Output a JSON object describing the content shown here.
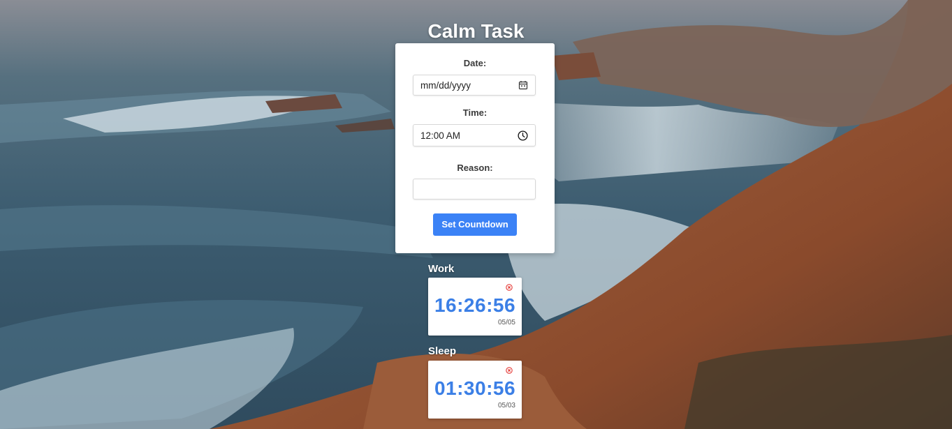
{
  "app": {
    "title": "Calm Task"
  },
  "form": {
    "date_label": "Date:",
    "date_value": "mm/dd/yyyy",
    "date_icon": "calendar-icon",
    "time_label": "Time:",
    "time_value": "12:00 AM",
    "time_icon": "clock-icon",
    "reason_label": "Reason:",
    "reason_value": "",
    "submit_label": "Set Countdown"
  },
  "countdowns": [
    {
      "title": "Work",
      "time": "16:26:56",
      "date": "05/05",
      "icon": "close-icon"
    },
    {
      "title": "Sleep",
      "time": "01:30:56",
      "date": "05/03",
      "icon": "close-icon"
    }
  ],
  "colors": {
    "accent": "#3b82f6",
    "countdown_text": "#3b7fe6",
    "close_icon": "#e53935",
    "sea": "#3e5f74",
    "rock": "#8a4e30"
  }
}
